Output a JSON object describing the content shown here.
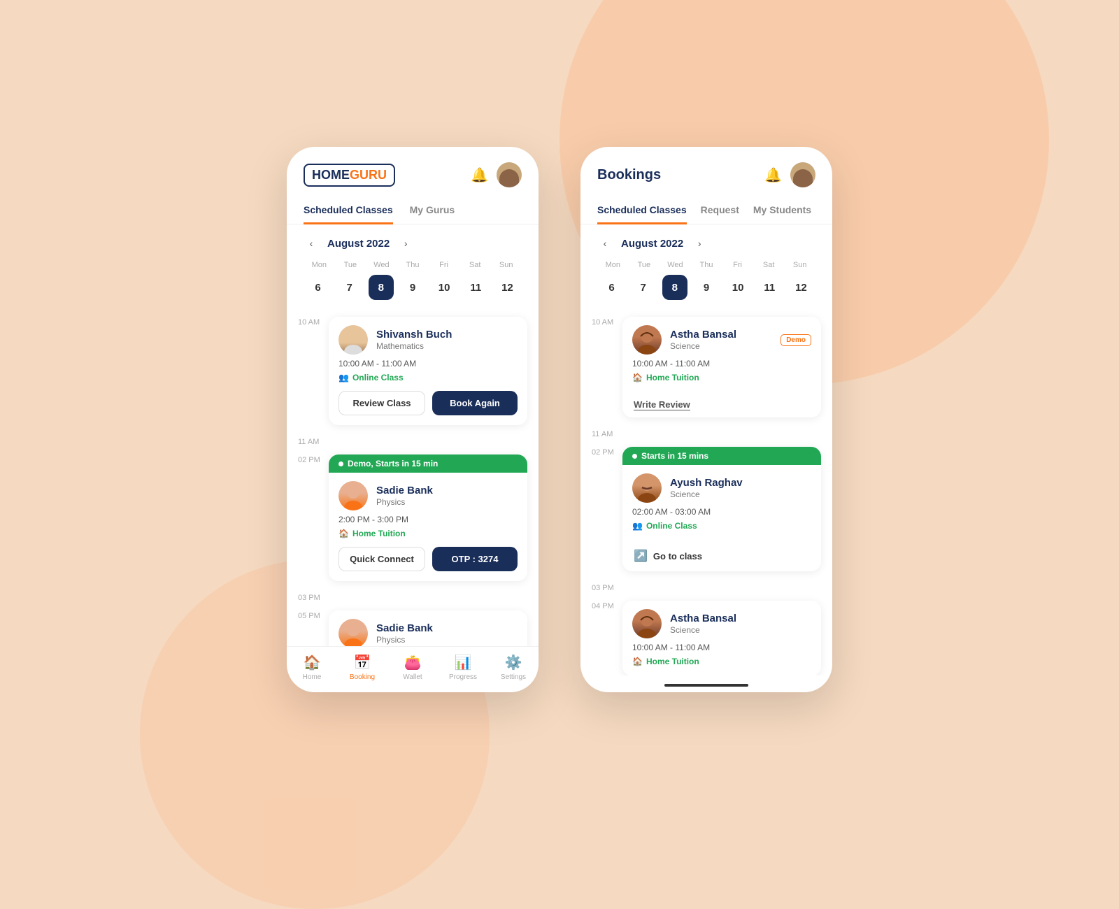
{
  "background": "#f5d9c0",
  "phone1": {
    "logo": {
      "home": "HOME",
      "guru": "GURU"
    },
    "header_icons": {
      "bell": "🔔",
      "avatar": "user"
    },
    "tabs": [
      {
        "label": "Scheduled Classes",
        "active": true
      },
      {
        "label": "My Gurus",
        "active": false
      }
    ],
    "calendar": {
      "month": "August 2022",
      "days": [
        "Mon",
        "Tue",
        "Wed",
        "Thu",
        "Fri",
        "Sat",
        "Sun"
      ],
      "dates": [
        "6",
        "7",
        "8",
        "9",
        "10",
        "11",
        "12"
      ],
      "active_date": "8"
    },
    "schedule": [
      {
        "time": "10 AM",
        "name": "Shivansh Buch",
        "subject": "Mathematics",
        "slot": "10:00 AM - 11:00 AM",
        "type": "Online Class",
        "type_color": "#22a855",
        "actions": [
          "Review Class",
          "Book Again"
        ],
        "demo_banner": null,
        "avatar_style": "face-1"
      },
      {
        "time": "02 PM",
        "name": "Sadie Bank",
        "subject": "Physics",
        "slot": "2:00 PM - 3:00 PM",
        "type": "Home Tuition",
        "type_color": "#22a855",
        "actions": [
          "Quick Connect",
          "OTP : 3274"
        ],
        "demo_banner": "Demo, Starts in 15 min",
        "avatar_style": "face-2"
      },
      {
        "time": "05 PM",
        "name": "Sadie Bank",
        "subject": "Physics",
        "slot": "",
        "type": "",
        "type_color": "",
        "actions": [],
        "demo_banner": null,
        "avatar_style": "face-2"
      }
    ],
    "bottom_nav": [
      {
        "label": "Home",
        "icon": "🏠",
        "active": false
      },
      {
        "label": "Booking",
        "icon": "📅",
        "active": true
      },
      {
        "label": "Wallet",
        "icon": "👛",
        "active": false
      },
      {
        "label": "Progress",
        "icon": "📊",
        "active": false
      },
      {
        "label": "Settings",
        "icon": "⚙️",
        "active": false
      }
    ]
  },
  "phone2": {
    "title": "Bookings",
    "tabs": [
      {
        "label": "Scheduled Classes",
        "active": true
      },
      {
        "label": "Request",
        "active": false
      },
      {
        "label": "My Students",
        "active": false
      }
    ],
    "calendar": {
      "month": "August 2022",
      "days": [
        "Mon",
        "Tue",
        "Wed",
        "Thu",
        "Fri",
        "Sat",
        "Sun"
      ],
      "dates": [
        "6",
        "7",
        "8",
        "9",
        "10",
        "11",
        "12"
      ],
      "active_date": "8"
    },
    "schedule": [
      {
        "time": "10 AM",
        "name": "Astha Bansal",
        "subject": "Science",
        "slot": "10:00 AM - 11:00 AM",
        "type": "Home Tuition",
        "type_color": "#22a855",
        "demo_badge": "Demo",
        "action": "write_review",
        "action_label": "Write Review",
        "avatar_style": "face-3"
      },
      {
        "time": "02 PM",
        "name": "Ayush Raghav",
        "subject": "Science",
        "slot": "02:00 AM - 03:00 AM",
        "type": "Online Class",
        "type_color": "#22a855",
        "demo_banner": "Starts in 15 mins",
        "action": "go_to_class",
        "action_label": "Go to class",
        "demo_badge": null,
        "avatar_style": "face-4"
      },
      {
        "time": "04 PM",
        "name": "Astha Bansal",
        "subject": "Science",
        "slot": "10:00 AM - 11:00 AM",
        "type": "Home Tuition",
        "type_color": "#22a855",
        "demo_badge": null,
        "action": null,
        "avatar_style": "face-3"
      }
    ]
  }
}
